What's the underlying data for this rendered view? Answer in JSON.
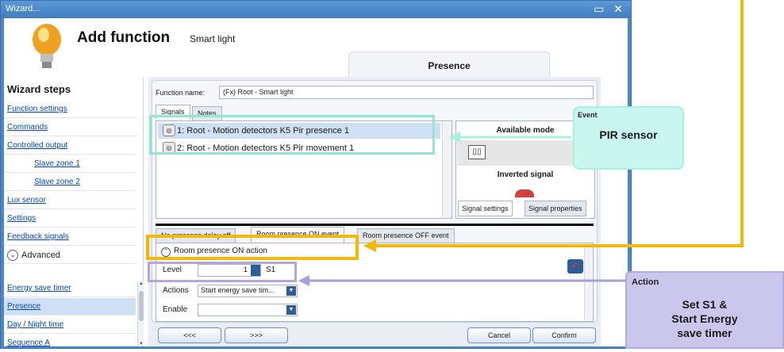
{
  "window": {
    "title": "Wizard...",
    "controls": "▭ ✕"
  },
  "header": {
    "title": "Add function",
    "subtitle": "Smart light",
    "section": "Presence"
  },
  "sidebar": {
    "heading": "Wizard steps",
    "items": [
      {
        "label": "Function settings"
      },
      {
        "label": "Commands"
      },
      {
        "label": "Controlled output"
      },
      {
        "label": "Slave zone 1"
      },
      {
        "label": "Slave zone 2"
      },
      {
        "label": "Lux sensor"
      },
      {
        "label": "Settings"
      },
      {
        "label": "Feedback signals"
      }
    ],
    "advanced": "Advanced",
    "advanced_items": [
      {
        "label": "Energy save timer"
      },
      {
        "label": "Presence"
      },
      {
        "label": "Day / Night time"
      },
      {
        "label": "Sequence A"
      }
    ]
  },
  "form": {
    "function_name_label": "Function name:",
    "function_name_value": "(Fx) Root - Smart light",
    "tabs": [
      "Signals",
      "Notes"
    ],
    "signals": [
      {
        "label": "1: Root - Motion detectors K5 Pir presence 1"
      },
      {
        "label": "2: Root - Motion detectors K5 Pir movement 1"
      }
    ],
    "available_mode": "Available mode",
    "inverted_signal": "Inverted signal",
    "signal_settings": "Signal settings",
    "signal_properties": "Signal properties",
    "event_tabs": [
      "No presence delay off",
      "Room presence ON event",
      "Room presence OFF event"
    ],
    "action_header": "Room presence ON action",
    "level_label": "Level",
    "level_value": "1",
    "level_scenario": "S1",
    "actions_label": "Actions",
    "actions_value": "Start energy save tim...",
    "enable_label": "Enable",
    "enable_value": ""
  },
  "buttons": {
    "prev": "<<<",
    "next": ">>>",
    "cancel": "Cancel",
    "confirm": "Confirm"
  },
  "callouts": {
    "event": {
      "tag": "Event",
      "text": "PIR sensor"
    },
    "action": {
      "tag": "Action",
      "line1": "Set S1 &",
      "line2": "Start Energy",
      "line3": "save timer"
    }
  },
  "colors": {
    "highlight_yellow": "#f5b800",
    "highlight_cyan": "#8fe7d4",
    "highlight_purple": "#b4a6dd",
    "selection": "#cfe0f4"
  }
}
